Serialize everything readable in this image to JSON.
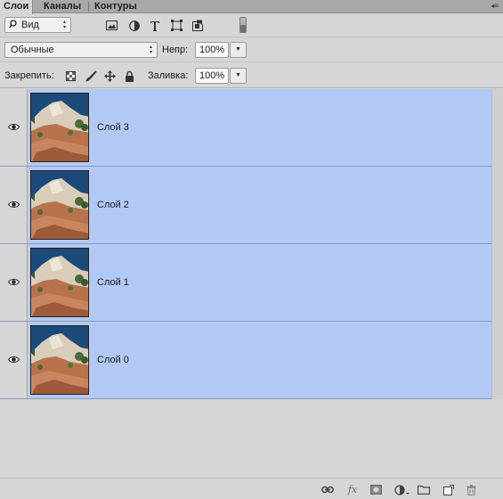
{
  "tabs": [
    {
      "label": "Слои",
      "active": true
    },
    {
      "label": "Каналы",
      "active": false
    },
    {
      "label": "Контуры",
      "active": false
    }
  ],
  "filter": {
    "label": "Вид",
    "icons": [
      "image-filter-icon",
      "adjustment-filter-icon",
      "type-filter-icon",
      "shape-filter-icon",
      "smart-object-filter-icon"
    ]
  },
  "blend": {
    "mode": "Обычные",
    "opacity_label": "Непр:",
    "opacity_value": "100%"
  },
  "lock": {
    "label": "Закрепить:",
    "icons": [
      "lock-transparent-icon",
      "lock-image-icon",
      "lock-position-icon",
      "lock-all-icon"
    ],
    "fill_label": "Заливка:",
    "fill_value": "100%"
  },
  "layers": [
    {
      "name": "Слой 3",
      "visible": true,
      "selected": true
    },
    {
      "name": "Слой 2",
      "visible": true,
      "selected": true
    },
    {
      "name": "Слой 1",
      "visible": true,
      "selected": true
    },
    {
      "name": "Слой 0",
      "visible": true,
      "selected": true
    }
  ],
  "bottom_toolbar": [
    "link-layers-icon",
    "fx-icon",
    "add-mask-icon",
    "adjustment-layer-icon",
    "new-group-icon",
    "new-layer-icon",
    "delete-layer-icon"
  ],
  "colors": {
    "selected_row": "#b3c9f5",
    "panel_bg": "#d6d6d6"
  }
}
